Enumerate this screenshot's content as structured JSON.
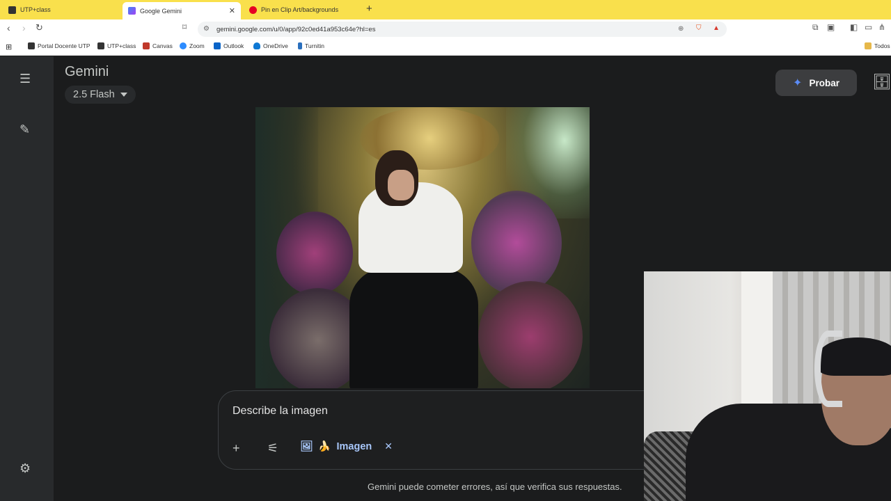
{
  "browser": {
    "tabs": [
      {
        "label": "UTP+class",
        "active": false
      },
      {
        "label": "Google Gemini",
        "active": true
      },
      {
        "label": "Pin en Clip Art/backgrounds",
        "active": false
      }
    ],
    "url": "gemini.google.com/u/0/app/92c0ed41a953c64e?hl=es",
    "bookmarks": [
      "Portal Docente UTP",
      "UTP+class",
      "Canvas",
      "Zoom",
      "Outlook",
      "OneDrive",
      "Turnitin"
    ],
    "bookmarks_folder": "Todos",
    "colors": {
      "tabbar": "#f9e04c"
    }
  },
  "app": {
    "title": "Gemini",
    "model": "2.5 Flash",
    "try_button": "Probar",
    "prompt_text": "Describe la imagen",
    "tool_chip": {
      "emoji": "🍌",
      "label": "Imagen",
      "close": "✕"
    },
    "disclaimer": "Gemini puede cometer errores, así que verifica sus respuestas.",
    "colors": {
      "background": "#1b1c1d",
      "sidebar": "#282a2c",
      "chip": "#a8c7fa"
    }
  },
  "icons": {
    "menu": "☰",
    "new_chat": "✎",
    "settings": "⚙",
    "plus": "+",
    "tools": "⚟",
    "image_tool": "🖼",
    "archive": "🗄",
    "sparkle": "✦"
  }
}
